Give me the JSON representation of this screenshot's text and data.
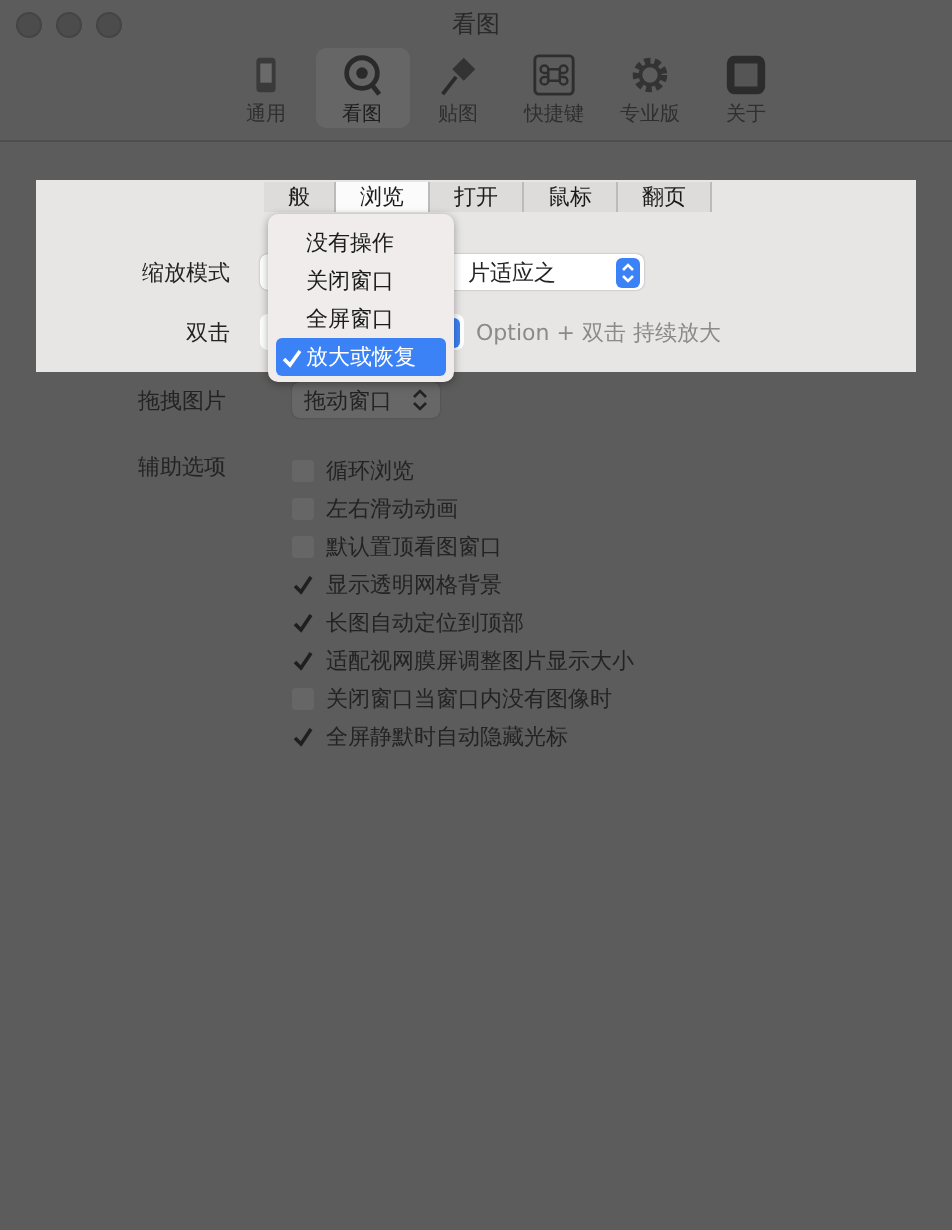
{
  "window": {
    "title": "看图"
  },
  "toolbar": [
    {
      "label": "通用",
      "selected": false,
      "kind": "phone"
    },
    {
      "label": "看图",
      "selected": true,
      "kind": "lens"
    },
    {
      "label": "贴图",
      "selected": false,
      "kind": "pin"
    },
    {
      "label": "快捷键",
      "selected": false,
      "kind": "command"
    },
    {
      "label": "专业版",
      "selected": false,
      "kind": "gear"
    },
    {
      "label": "关于",
      "selected": false,
      "kind": "square"
    }
  ],
  "tabs": [
    {
      "label": "般",
      "selected": false
    },
    {
      "label": "浏览",
      "selected": true
    },
    {
      "label": "打开",
      "selected": false
    },
    {
      "label": "鼠标",
      "selected": false
    },
    {
      "label": "翻页",
      "selected": false
    }
  ],
  "zoom_mode": {
    "label": "缩放模式",
    "value": "片适应之"
  },
  "double_click": {
    "label": "双击",
    "hint": "Option + 双击 持续放大"
  },
  "drag": {
    "label": "拖拽图片",
    "value": "拖动窗口"
  },
  "aux": {
    "label": "辅助选项",
    "options": [
      {
        "label": "循环浏览",
        "checked": false
      },
      {
        "label": "左右滑动动画",
        "checked": false
      },
      {
        "label": "默认置顶看图窗口",
        "checked": false
      },
      {
        "label": "显示透明网格背景",
        "checked": true
      },
      {
        "label": "长图自动定位到顶部",
        "checked": true
      },
      {
        "label": "适配视网膜屏调整图片显示大小",
        "checked": true
      },
      {
        "label": "关闭窗口当窗口内没有图像时",
        "checked": false
      },
      {
        "label": "全屏静默时自动隐藏光标",
        "checked": true
      }
    ]
  },
  "menu": {
    "items": [
      {
        "label": "没有操作",
        "selected": false
      },
      {
        "label": "关闭窗口",
        "selected": false
      },
      {
        "label": "全屏窗口",
        "selected": false
      },
      {
        "label": "放大或恢复",
        "selected": true
      }
    ]
  }
}
